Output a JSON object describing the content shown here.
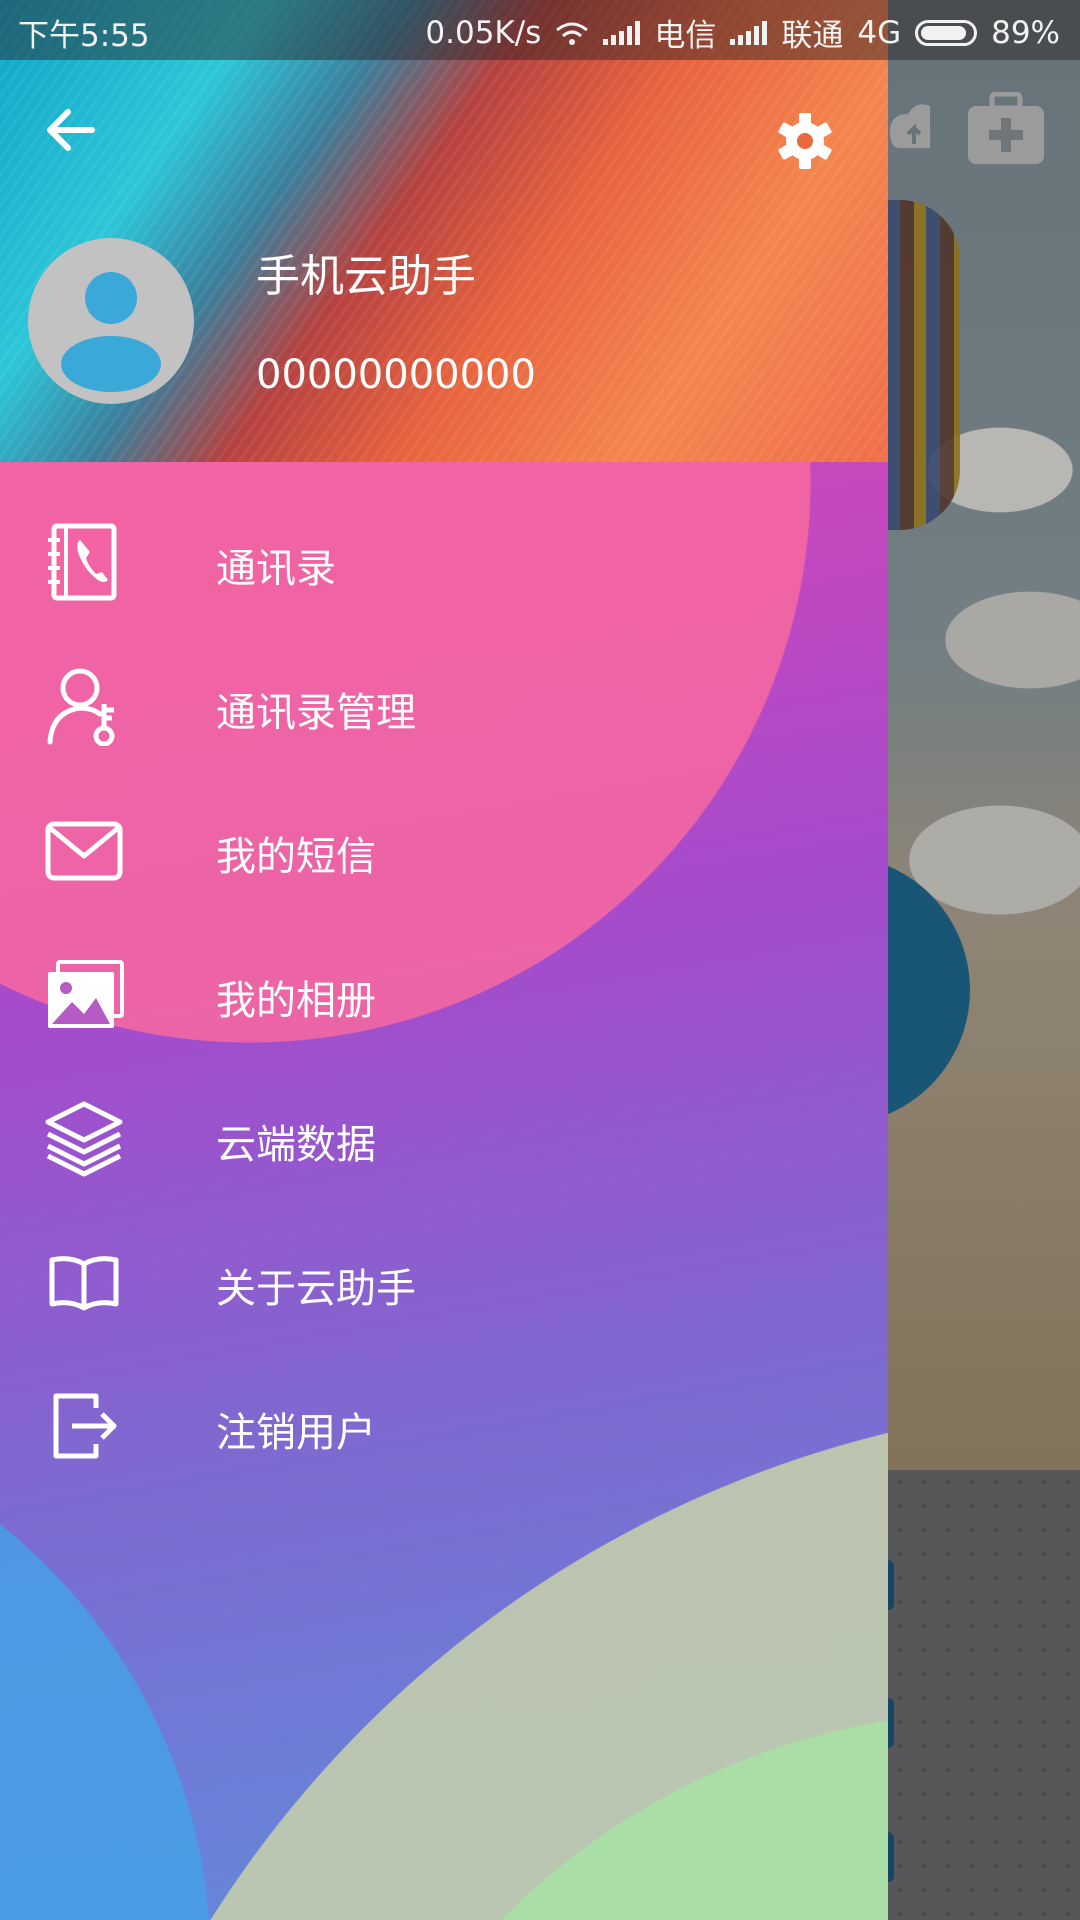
{
  "status_bar": {
    "time": "下午5:55",
    "speed": "0.05K/s",
    "carrier1": "电信",
    "carrier2": "联通",
    "network": "4G",
    "battery": "89%",
    "battery_level": 0.89
  },
  "drawer": {
    "header": {
      "app_name": "手机云助手",
      "phone": "00000000000",
      "back_icon": "arrow-left-icon",
      "settings_icon": "gear-icon",
      "avatar_icon": "person-icon"
    },
    "menu": [
      {
        "label": "通讯录",
        "icon": "address-book-icon"
      },
      {
        "label": "通讯录管理",
        "icon": "user-key-icon"
      },
      {
        "label": "我的短信",
        "icon": "envelope-icon"
      },
      {
        "label": "我的相册",
        "icon": "photo-album-icon"
      },
      {
        "label": "云端数据",
        "icon": "layers-icon"
      },
      {
        "label": "关于云助手",
        "icon": "open-book-icon"
      },
      {
        "label": "注销用户",
        "icon": "logout-icon"
      }
    ]
  },
  "background_app": {
    "toolbar_icons": [
      "cloud-upload-icon",
      "medical-kit-icon"
    ]
  }
}
